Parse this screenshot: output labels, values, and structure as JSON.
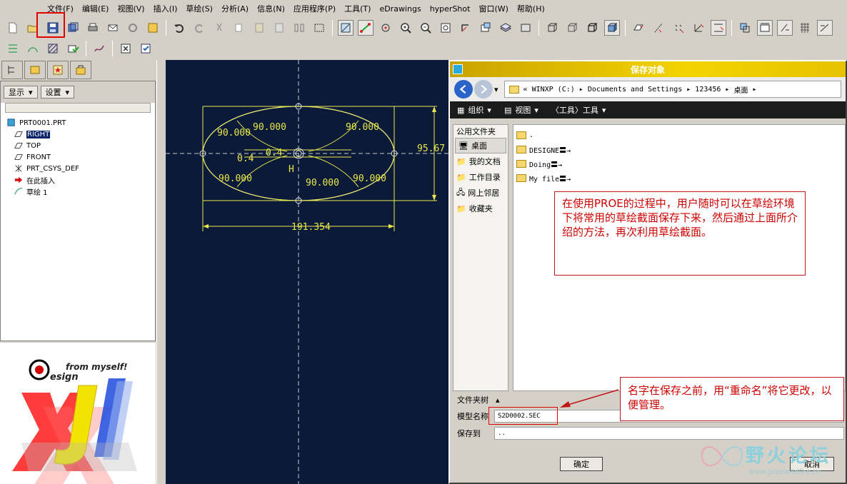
{
  "menu": [
    "文件(F)",
    "编辑(E)",
    "视图(V)",
    "插入(I)",
    "草绘(S)",
    "分析(A)",
    "信息(N)",
    "应用程序(P)",
    "工具(T)",
    "eDrawings",
    "hyperShot",
    "窗口(W)",
    "帮助(H)"
  ],
  "tree_panel": {
    "show_button": "显示",
    "settings_button": "设置",
    "nodes": [
      {
        "label": "PRT0001.PRT",
        "icon": "part-icon"
      },
      {
        "label": "RIGHT",
        "icon": "datum-plane-icon",
        "selected": true
      },
      {
        "label": "TOP",
        "icon": "datum-plane-icon"
      },
      {
        "label": "FRONT",
        "icon": "datum-plane-icon"
      },
      {
        "label": "PRT_CSYS_DEF",
        "icon": "csys-icon"
      },
      {
        "label": "在此插入",
        "icon": "insert-here-icon"
      },
      {
        "label": "草绘 1",
        "icon": "sketch-icon"
      }
    ]
  },
  "logo": {
    "tagline": "from myself!",
    "word": "esign",
    "letters": "xjl"
  },
  "sketch": {
    "dims": [
      "90.000",
      "90.000",
      "90.000",
      "90.000",
      "90.000",
      "90.000",
      "95.67",
      "191.354",
      "0.4",
      "0.4",
      "H"
    ]
  },
  "dialog": {
    "title": "保存对象",
    "address": [
      "«",
      "WINXP (C:)",
      "Documents and Settings",
      "123456",
      "桌面"
    ],
    "toolbar": [
      "组织",
      "视图",
      "〈工具〉工具"
    ],
    "places_header": "公用文件夹",
    "places": [
      "桌面",
      "我的文档",
      "工作目录",
      "网上邻居",
      "收藏夹"
    ],
    "files": [
      ".",
      "DESIGNE〓→",
      "Doing〓→",
      "My file〓→"
    ],
    "folder_tree_label": "文件夹树",
    "model_name_label": "模型名称",
    "model_name_value": "S2D0002.SEC",
    "save_to_label": "保存到",
    "save_to_value": "..",
    "ok": "确定",
    "cancel": "取消"
  },
  "annotations": {
    "note1": "在使用PROE的过程中，用户随时可以在草绘环境下将常用的草绘截面保存下来，然后通过上面所介绍的方法，再次利用草绘截面。",
    "note2": "名字在保存之前，用“重命名”将它更改，以便管理。"
  },
  "watermark": {
    "title": "野火论坛",
    "url": "www.proewildfire.cn"
  },
  "colors": {
    "canvas": "#0c1a3a",
    "sketch": "#e8e84a",
    "annotation": "#d00000",
    "title_bar": "#e6c200"
  }
}
